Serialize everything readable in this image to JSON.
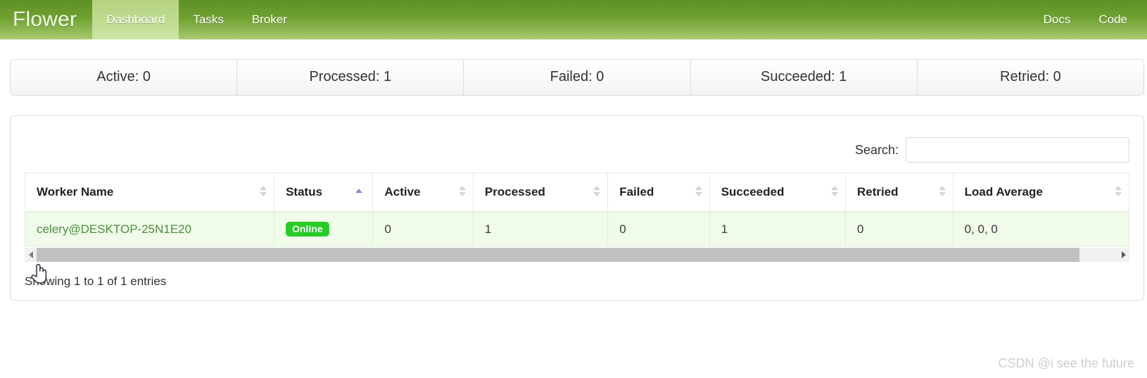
{
  "navbar": {
    "brand": "Flower",
    "items": [
      {
        "label": "Dashboard",
        "active": true
      },
      {
        "label": "Tasks",
        "active": false
      },
      {
        "label": "Broker",
        "active": false
      }
    ],
    "right_items": [
      {
        "label": "Docs"
      },
      {
        "label": "Code"
      }
    ]
  },
  "stats": [
    {
      "label": "Active: 0"
    },
    {
      "label": "Processed: 1"
    },
    {
      "label": "Failed: 0"
    },
    {
      "label": "Succeeded: 1"
    },
    {
      "label": "Retried: 0"
    }
  ],
  "search": {
    "label": "Search:",
    "value": "",
    "placeholder": ""
  },
  "table": {
    "columns": [
      {
        "label": "Worker Name",
        "sort": "none"
      },
      {
        "label": "Status",
        "sort": "asc"
      },
      {
        "label": "Active",
        "sort": "none"
      },
      {
        "label": "Processed",
        "sort": "none"
      },
      {
        "label": "Failed",
        "sort": "none"
      },
      {
        "label": "Succeeded",
        "sort": "none"
      },
      {
        "label": "Retried",
        "sort": "none"
      },
      {
        "label": "Load Average",
        "sort": "none"
      }
    ],
    "rows": [
      {
        "worker_name": "celery@DESKTOP-25N1E20",
        "status": "Online",
        "active": "0",
        "processed": "1",
        "failed": "0",
        "succeeded": "1",
        "retried": "0",
        "load_average": "0, 0, 0"
      }
    ]
  },
  "footer": {
    "info": "Showing 1 to 1 of 1 entries"
  },
  "watermark": "CSDN @i see the future",
  "colors": {
    "navbar_top": "#5d8f28",
    "navbar_bottom": "#a8c972",
    "nav_active": "#bedb8e",
    "row_bg": "#f0fbe9",
    "row_border": "#dff0d8",
    "link": "#4d8f3f",
    "badge_online": "#27cc27",
    "sort_active": "#8c8cdd"
  },
  "icons": {
    "sort_both": "sort-both-icon",
    "sort_asc": "sort-asc-icon",
    "scroll_left": "chevron-left-icon",
    "scroll_right": "chevron-right-icon",
    "cursor": "pointer-hand-cursor"
  }
}
